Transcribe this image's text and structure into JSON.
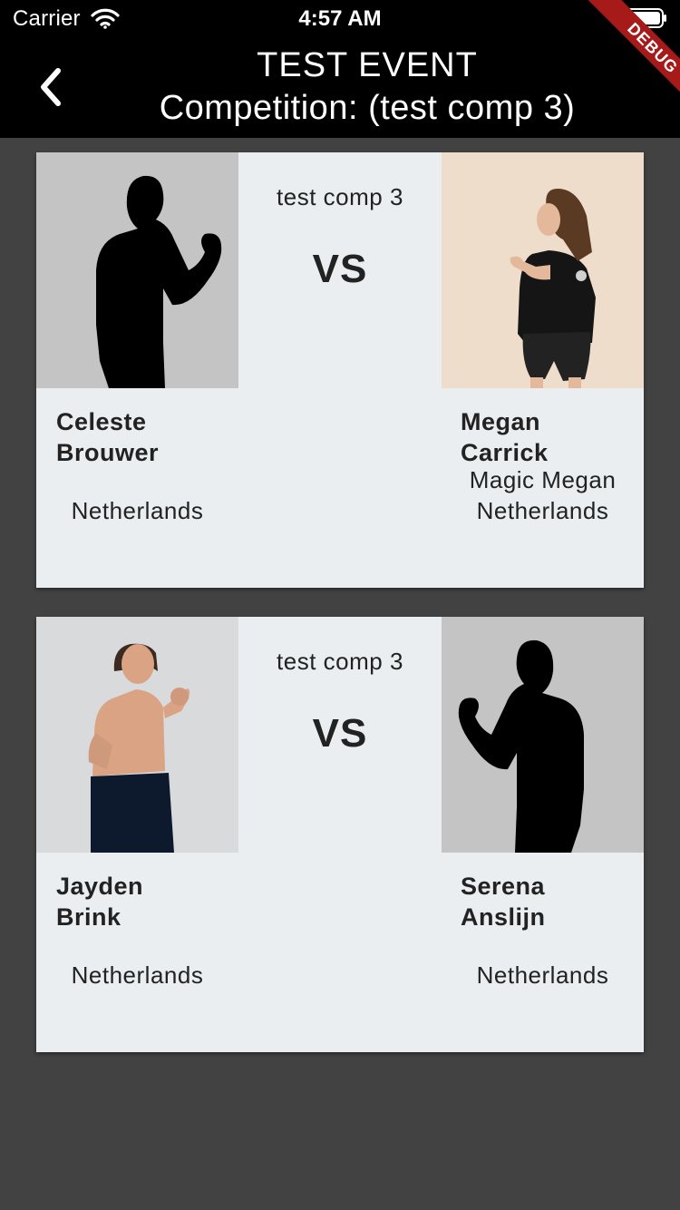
{
  "status_bar": {
    "carrier": "Carrier",
    "time": "4:57 AM"
  },
  "debug_label": "DEBUG",
  "app_bar": {
    "title": "TEST EVENT",
    "subtitle": "Competition: (test comp 3)"
  },
  "matches": [
    {
      "competition": "test comp 3",
      "vs_label": "VS",
      "left": {
        "first_name": "Celeste",
        "last_name": "Brouwer",
        "nickname": "",
        "country": "Netherlands",
        "photo": "silhouette"
      },
      "right": {
        "first_name": "Megan",
        "last_name": "Carrick",
        "nickname": "Magic Megan",
        "country": "Netherlands",
        "photo": "fighter-photo"
      }
    },
    {
      "competition": "test comp 3",
      "vs_label": "VS",
      "left": {
        "first_name": "Jayden",
        "last_name": "Brink",
        "nickname": "",
        "country": "Netherlands",
        "photo": "fighter-photo"
      },
      "right": {
        "first_name": "Serena",
        "last_name": "Anslijn",
        "nickname": "",
        "country": "Netherlands",
        "photo": "silhouette"
      }
    }
  ],
  "colors": {
    "background": "#424242",
    "card": "#eaeef1",
    "app_bar": "#000000",
    "debug_ribbon": "#a61a1a"
  }
}
